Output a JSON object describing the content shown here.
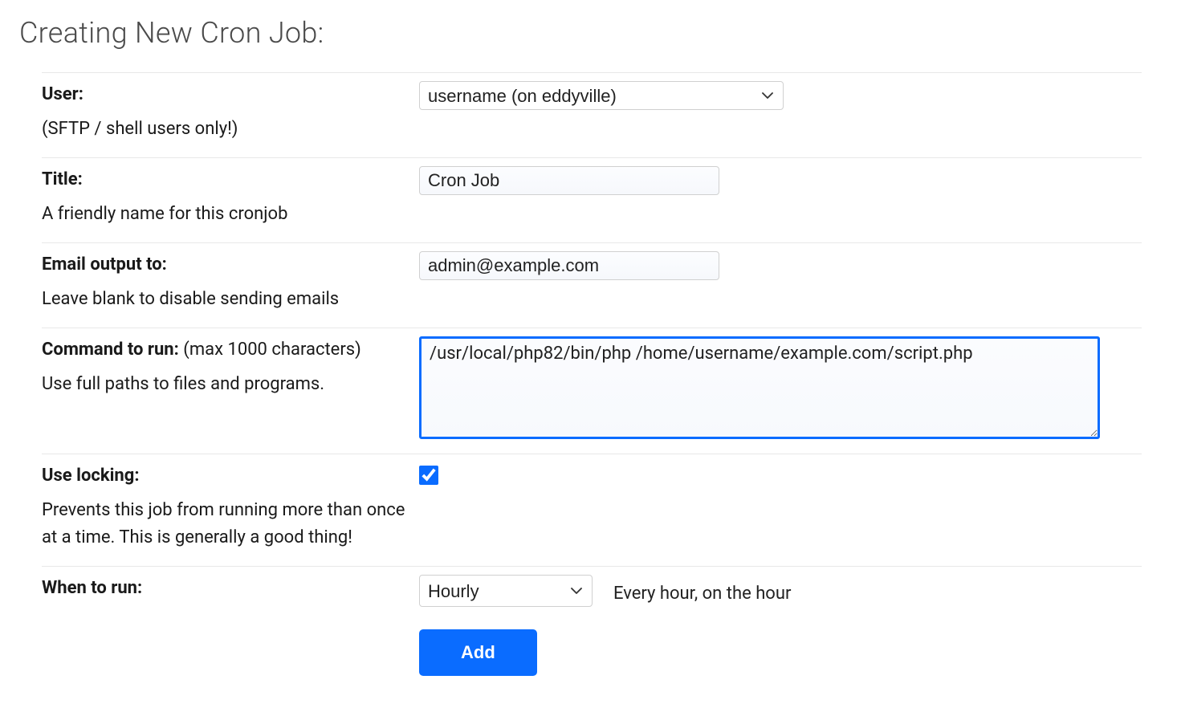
{
  "page_title": "Creating New Cron Job:",
  "rows": {
    "user": {
      "label": "User:",
      "sub": "(SFTP / shell users only!)",
      "selected": "username (on eddyville)"
    },
    "title": {
      "label": "Title:",
      "sub": "A friendly name for this cronjob",
      "value": "Cron Job"
    },
    "email": {
      "label": "Email output to:",
      "sub": "Leave blank to disable sending emails",
      "value": "admin@example.com"
    },
    "command": {
      "label": "Command to run:",
      "note": " (max 1000 characters)",
      "sub": "Use full paths to files and programs.",
      "value": "/usr/local/php82/bin/php /home/username/example.com/script.php"
    },
    "locking": {
      "label": "Use locking:",
      "sub": "Prevents this job from running more than once at a time. This is generally a good thing!",
      "checked": true
    },
    "when": {
      "label": "When to run:",
      "selected": "Hourly",
      "hint": "Every hour, on the hour"
    }
  },
  "buttons": {
    "add": "Add"
  }
}
